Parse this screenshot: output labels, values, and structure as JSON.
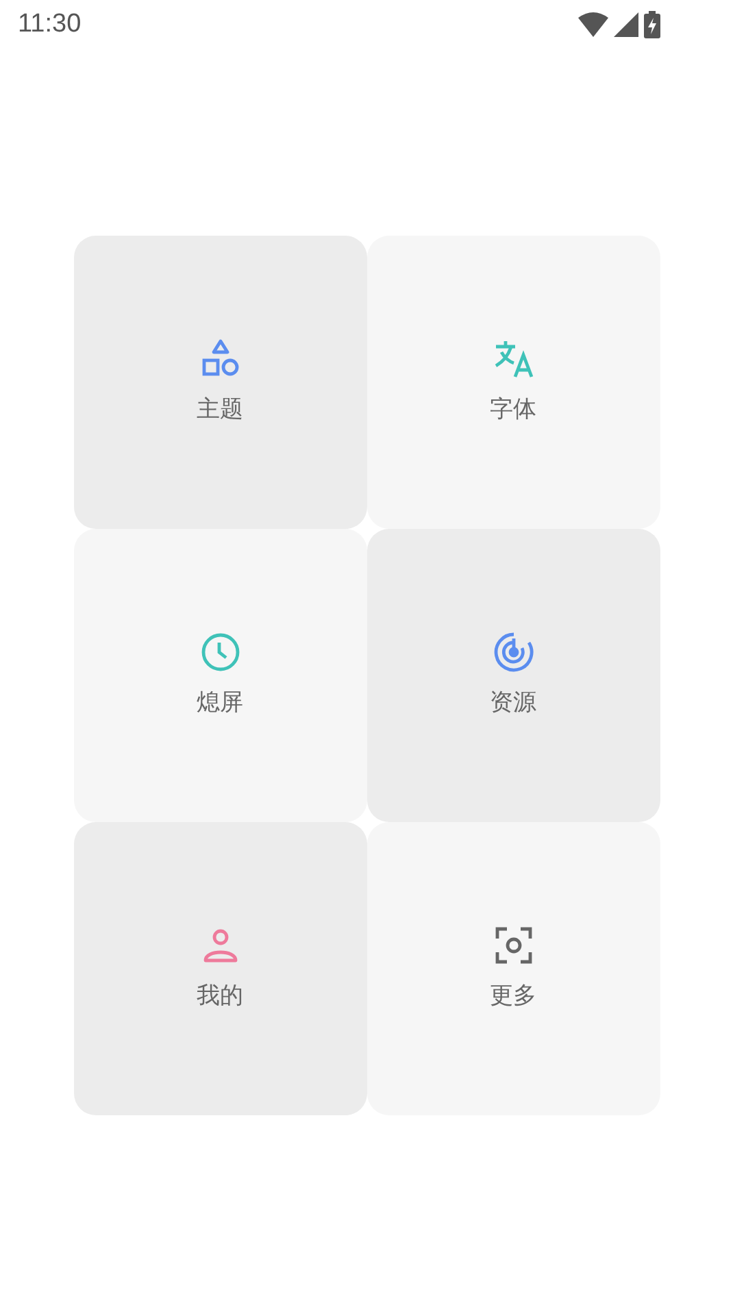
{
  "status_bar": {
    "time": "11:30"
  },
  "tiles": [
    {
      "kind": "shapes",
      "label": "主题",
      "color": "#5b8def"
    },
    {
      "kind": "translate",
      "label": "字体",
      "color": "#3fc2b8"
    },
    {
      "kind": "clock",
      "label": "熄屏",
      "color": "#3fc2b8"
    },
    {
      "kind": "radar",
      "label": "资源",
      "color": "#5b8def"
    },
    {
      "kind": "person",
      "label": "我的",
      "color": "#ee7a9b"
    },
    {
      "kind": "scan",
      "label": "更多",
      "color": "#666666"
    }
  ]
}
